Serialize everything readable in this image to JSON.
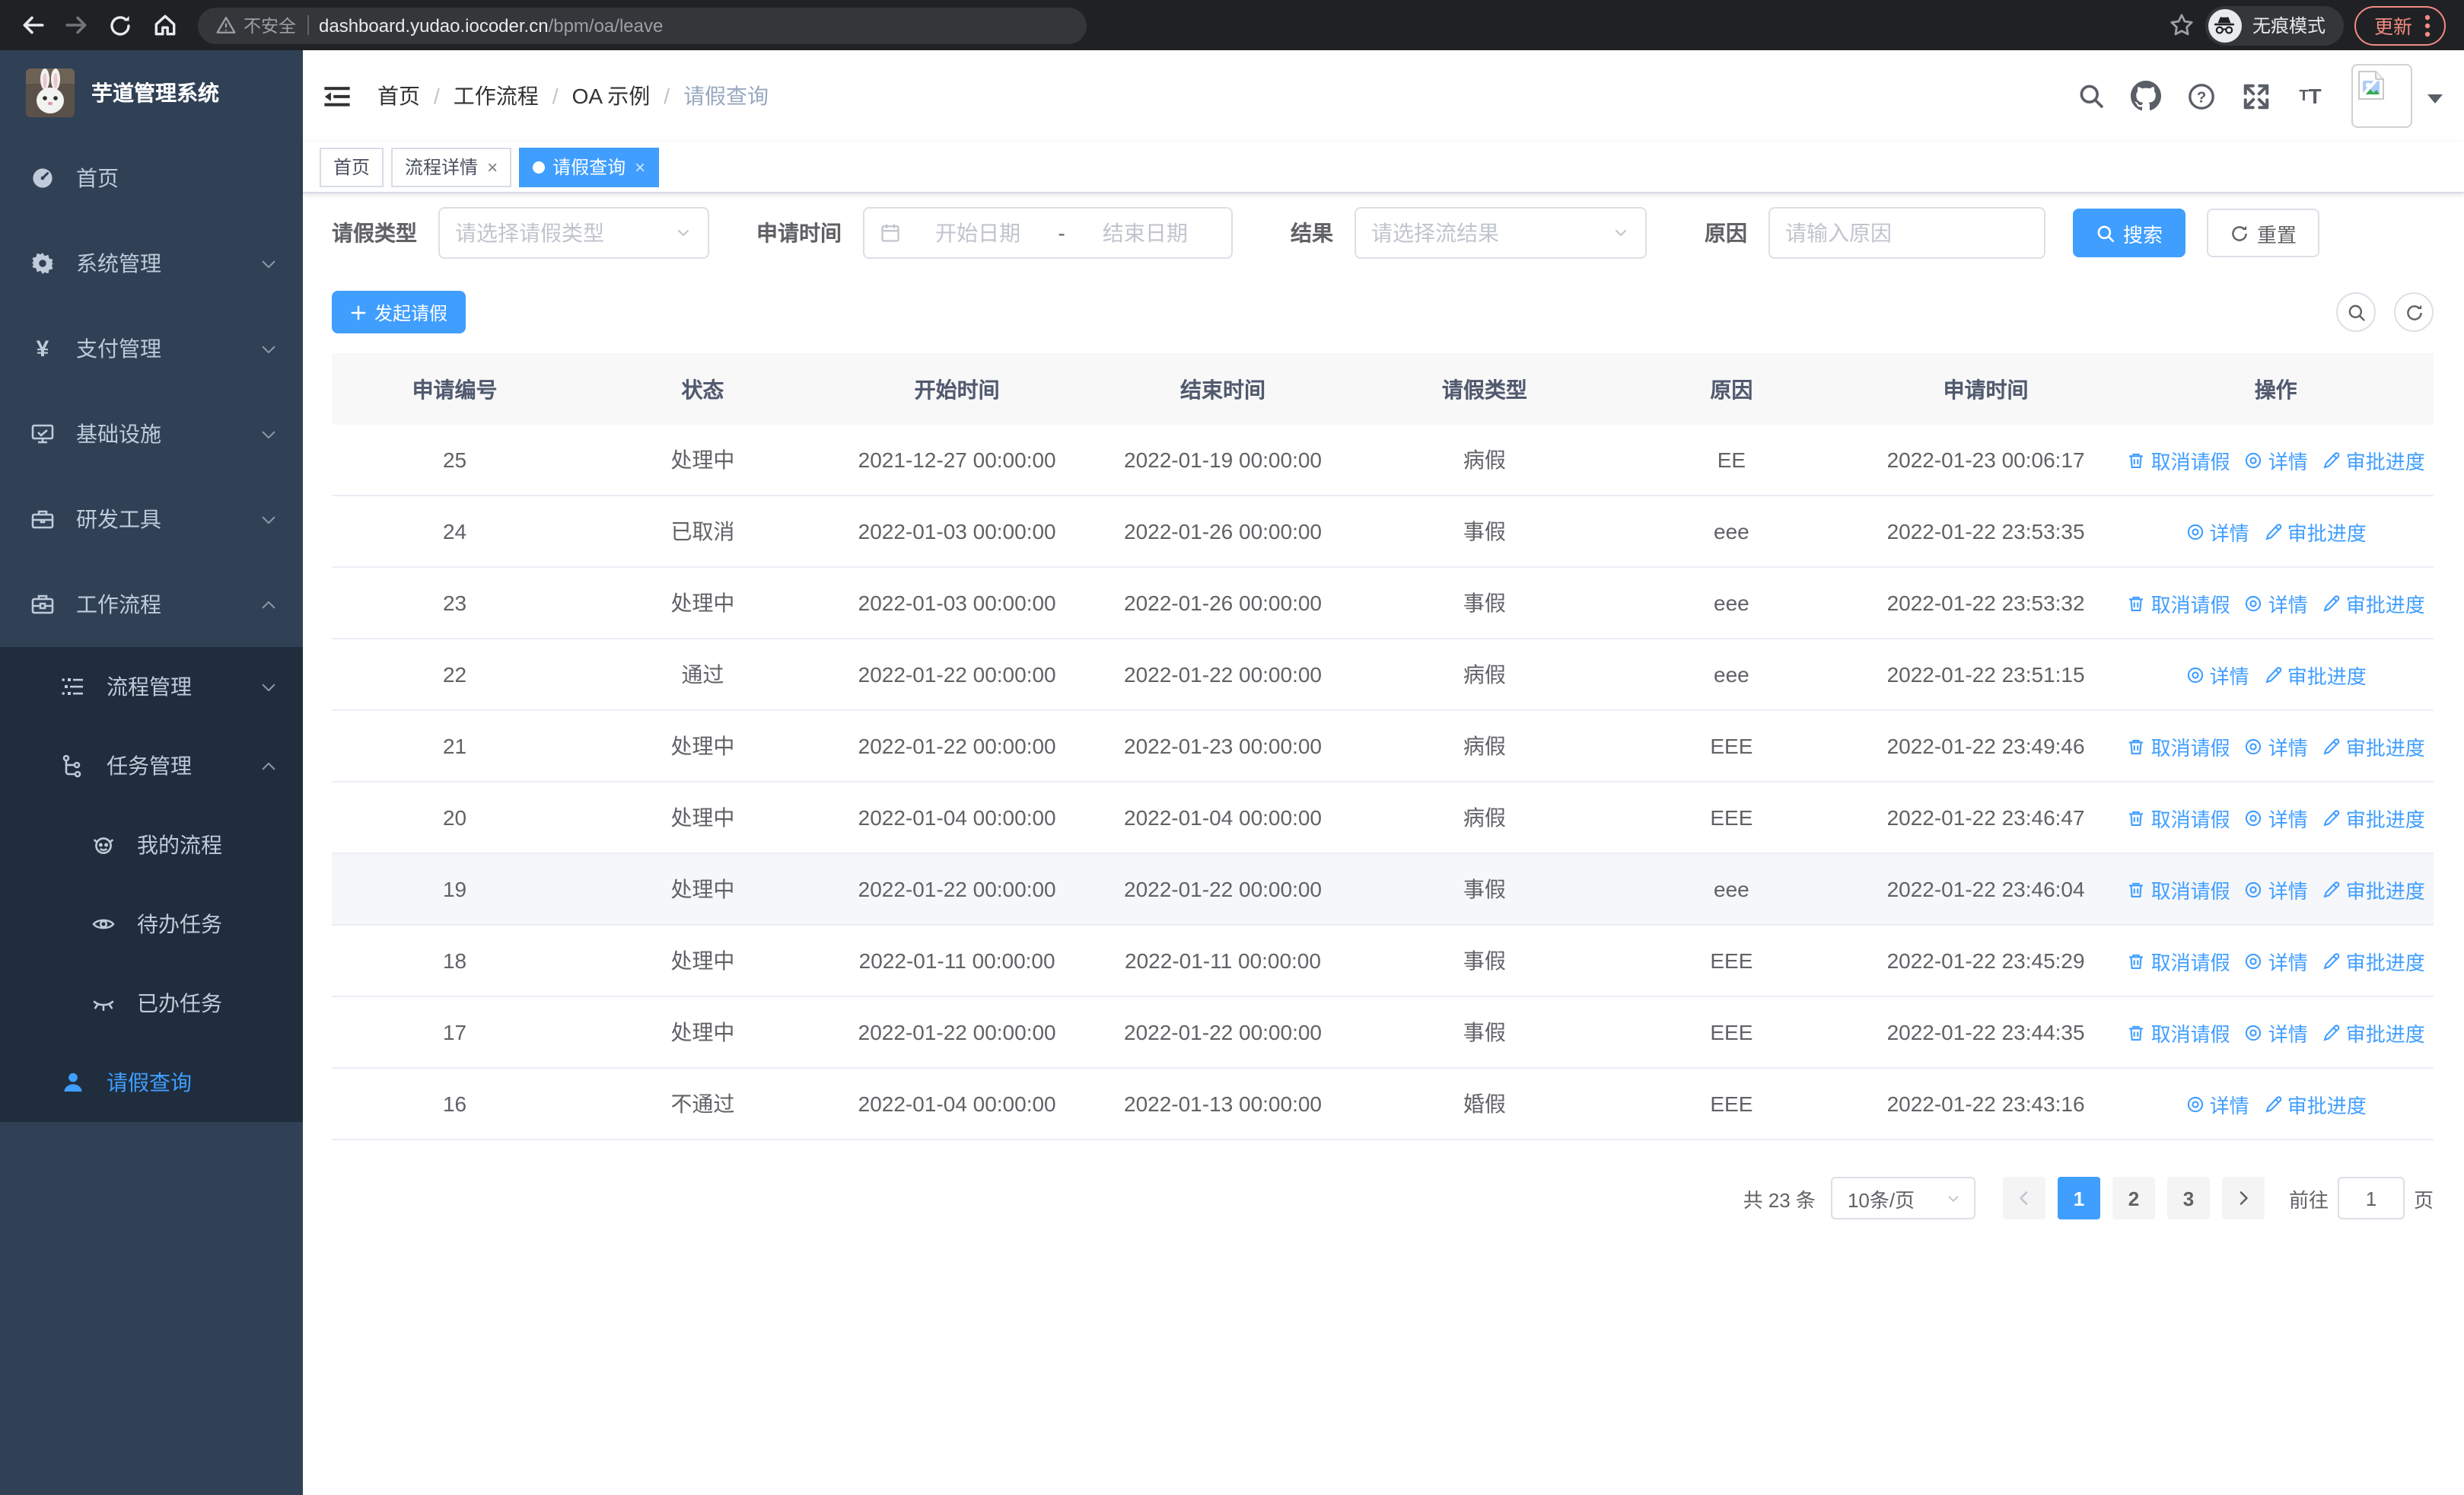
{
  "browser": {
    "security_warning": "不安全",
    "url_host": "dashboard.yudao.iocoder.cn",
    "url_path": "/bpm/oa/leave",
    "incognito_label": "无痕模式",
    "update_label": "更新"
  },
  "sidebar": {
    "app_title": "芋道管理系统",
    "items": [
      {
        "label": "首页",
        "icon": "dashboard-icon"
      },
      {
        "label": "系统管理",
        "icon": "gear-icon",
        "arrow": "down"
      },
      {
        "label": "支付管理",
        "icon": "yen-icon",
        "arrow": "down"
      },
      {
        "label": "基础设施",
        "icon": "monitor-icon",
        "arrow": "down"
      },
      {
        "label": "研发工具",
        "icon": "toolbox-icon",
        "arrow": "down"
      },
      {
        "label": "工作流程",
        "icon": "briefcase-icon",
        "arrow": "up"
      }
    ],
    "submenu": [
      {
        "label": "流程管理",
        "icon": "list-icon",
        "arrow": "down",
        "level": 1
      },
      {
        "label": "任务管理",
        "icon": "tree-icon",
        "arrow": "up",
        "level": 1
      },
      {
        "label": "我的流程",
        "icon": "robot-icon",
        "level": 2
      },
      {
        "label": "待办任务",
        "icon": "eye-icon",
        "level": 2
      },
      {
        "label": "已办任务",
        "icon": "eye-closed-icon",
        "level": 2
      },
      {
        "label": "请假查询",
        "icon": "user-icon",
        "level": 1,
        "active": true
      }
    ]
  },
  "breadcrumb": [
    "首页",
    "工作流程",
    "OA 示例",
    "请假查询"
  ],
  "tabs": [
    {
      "label": "首页",
      "closable": false,
      "active": false
    },
    {
      "label": "流程详情",
      "closable": true,
      "active": false
    },
    {
      "label": "请假查询",
      "closable": true,
      "active": true
    }
  ],
  "filters": {
    "leave_type_label": "请假类型",
    "leave_type_placeholder": "请选择请假类型",
    "apply_time_label": "申请时间",
    "date_start_placeholder": "开始日期",
    "date_separator": "-",
    "date_end_placeholder": "结束日期",
    "result_label": "结果",
    "result_placeholder": "请选择流结果",
    "reason_label": "原因",
    "reason_placeholder": "请输入原因",
    "search_label": "搜索",
    "search_icon": "search-icon",
    "reset_label": "重置",
    "reset_icon": "refresh-icon"
  },
  "toolbar": {
    "create_label": "发起请假",
    "create_icon": "plus-icon",
    "right_icons": [
      "search-icon",
      "refresh-icon"
    ]
  },
  "table": {
    "columns": [
      "申请编号",
      "状态",
      "开始时间",
      "结束时间",
      "请假类型",
      "原因",
      "申请时间",
      "操作"
    ],
    "action_labels": {
      "cancel": "取消请假",
      "detail": "详情",
      "progress": "审批进度"
    },
    "action_icons": {
      "cancel": "trash-icon",
      "detail": "view-icon",
      "progress": "pen-icon"
    },
    "rows": [
      {
        "id": "25",
        "status": "处理中",
        "start": "2021-12-27 00:00:00",
        "end": "2022-01-19 00:00:00",
        "type": "病假",
        "reason": "EE",
        "applied": "2022-01-23 00:06:17",
        "actions": [
          "cancel",
          "detail",
          "progress"
        ],
        "highlighted": false
      },
      {
        "id": "24",
        "status": "已取消",
        "start": "2022-01-03 00:00:00",
        "end": "2022-01-26 00:00:00",
        "type": "事假",
        "reason": "eee",
        "applied": "2022-01-22 23:53:35",
        "actions": [
          "detail",
          "progress"
        ],
        "highlighted": false
      },
      {
        "id": "23",
        "status": "处理中",
        "start": "2022-01-03 00:00:00",
        "end": "2022-01-26 00:00:00",
        "type": "事假",
        "reason": "eee",
        "applied": "2022-01-22 23:53:32",
        "actions": [
          "cancel",
          "detail",
          "progress"
        ],
        "highlighted": false
      },
      {
        "id": "22",
        "status": "通过",
        "start": "2022-01-22 00:00:00",
        "end": "2022-01-22 00:00:00",
        "type": "病假",
        "reason": "eee",
        "applied": "2022-01-22 23:51:15",
        "actions": [
          "detail",
          "progress"
        ],
        "highlighted": false
      },
      {
        "id": "21",
        "status": "处理中",
        "start": "2022-01-22 00:00:00",
        "end": "2022-01-23 00:00:00",
        "type": "病假",
        "reason": "EEE",
        "applied": "2022-01-22 23:49:46",
        "actions": [
          "cancel",
          "detail",
          "progress"
        ],
        "highlighted": false
      },
      {
        "id": "20",
        "status": "处理中",
        "start": "2022-01-04 00:00:00",
        "end": "2022-01-04 00:00:00",
        "type": "病假",
        "reason": "EEE",
        "applied": "2022-01-22 23:46:47",
        "actions": [
          "cancel",
          "detail",
          "progress"
        ],
        "highlighted": false
      },
      {
        "id": "19",
        "status": "处理中",
        "start": "2022-01-22 00:00:00",
        "end": "2022-01-22 00:00:00",
        "type": "事假",
        "reason": "eee",
        "applied": "2022-01-22 23:46:04",
        "actions": [
          "cancel",
          "detail",
          "progress"
        ],
        "highlighted": true
      },
      {
        "id": "18",
        "status": "处理中",
        "start": "2022-01-11 00:00:00",
        "end": "2022-01-11 00:00:00",
        "type": "事假",
        "reason": "EEE",
        "applied": "2022-01-22 23:45:29",
        "actions": [
          "cancel",
          "detail",
          "progress"
        ],
        "highlighted": false
      },
      {
        "id": "17",
        "status": "处理中",
        "start": "2022-01-22 00:00:00",
        "end": "2022-01-22 00:00:00",
        "type": "事假",
        "reason": "EEE",
        "applied": "2022-01-22 23:44:35",
        "actions": [
          "cancel",
          "detail",
          "progress"
        ],
        "highlighted": false
      },
      {
        "id": "16",
        "status": "不通过",
        "start": "2022-01-04 00:00:00",
        "end": "2022-01-13 00:00:00",
        "type": "婚假",
        "reason": "EEE",
        "applied": "2022-01-22 23:43:16",
        "actions": [
          "detail",
          "progress"
        ],
        "highlighted": false
      }
    ]
  },
  "pagination": {
    "total_label": "共 23 条",
    "page_size": "10条/页",
    "pages": [
      "1",
      "2",
      "3"
    ],
    "active_page": "1",
    "goto_label": "前往",
    "goto_value": "1",
    "page_suffix": "页"
  },
  "colors": {
    "primary": "#409EFF",
    "sidebar_bg": "#304156",
    "submenu_bg": "#1f2d3d",
    "menu_text": "#bfcbd9",
    "table_header_bg": "#f8f8f9",
    "table_header_text": "#515a6e",
    "cell_text": "#606266",
    "chrome_bg": "#202124",
    "update_red": "#f28b82"
  }
}
